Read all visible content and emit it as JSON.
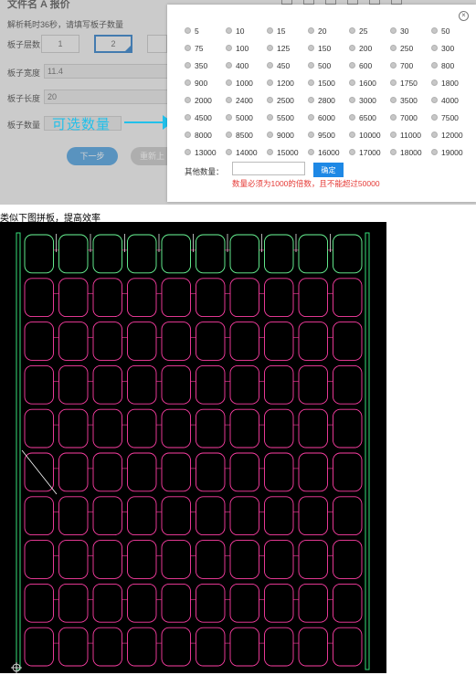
{
  "background_form": {
    "title": "文件名 A 报价",
    "hint": "解析耗时36秒，请填写板子数量",
    "layer_label": "板子层数",
    "layer_options": [
      "1",
      "2"
    ],
    "width_label": "板子宽度",
    "width_value": "11.4",
    "length_label": "板子长度",
    "length_value": "20",
    "quantity_label": "板子数量",
    "next_button": "下一步",
    "reset_button": "重新上"
  },
  "callout": {
    "text": "可选数量"
  },
  "quantity_modal": {
    "options": [
      "5",
      "10",
      "15",
      "20",
      "25",
      "30",
      "50",
      "75",
      "100",
      "125",
      "150",
      "200",
      "250",
      "300",
      "350",
      "400",
      "450",
      "500",
      "600",
      "700",
      "800",
      "900",
      "1000",
      "1200",
      "1500",
      "1600",
      "1750",
      "1800",
      "2000",
      "2400",
      "2500",
      "2800",
      "3000",
      "3500",
      "4000",
      "4500",
      "5000",
      "5500",
      "6000",
      "6500",
      "7000",
      "7500",
      "8000",
      "8500",
      "9000",
      "9500",
      "10000",
      "11000",
      "12000",
      "13000",
      "14000",
      "15000",
      "16000",
      "17000",
      "18000",
      "19000"
    ],
    "other_label": "其他数量：",
    "other_value": "",
    "confirm_button": "确定",
    "warning": "数量必须为1000的倍数，且不能超过50000",
    "close_icon": "close-circle-icon"
  },
  "caption": "类似下图拼板，提高效率",
  "panel_preview": {
    "columns": 10,
    "rows": 10,
    "colors": {
      "background": "#000000",
      "unit": "#ff3fa5",
      "top_row": "#6cff9a",
      "rails": "#36e07a",
      "slot": "#ffffff"
    }
  }
}
